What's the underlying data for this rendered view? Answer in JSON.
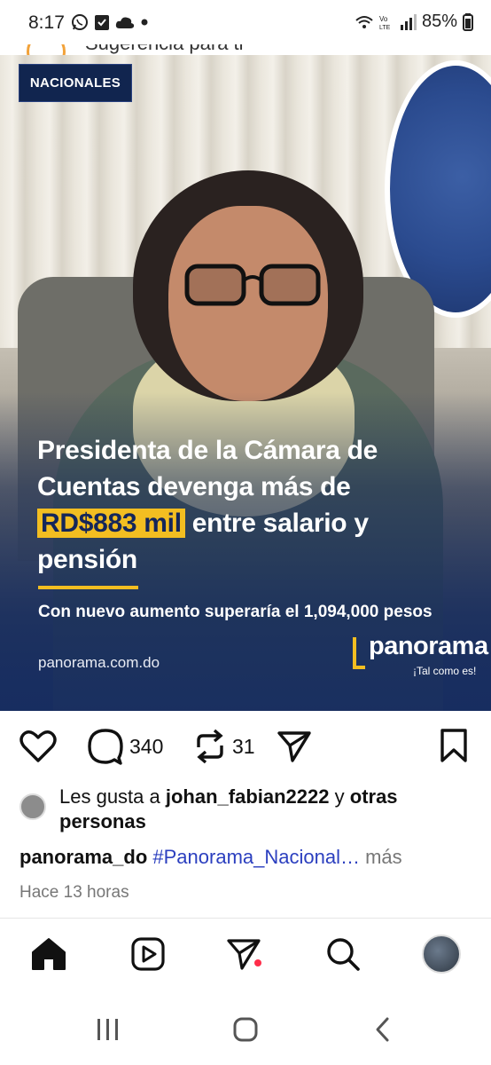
{
  "status_bar": {
    "time": "8:17",
    "battery": "85%",
    "left_icons": [
      "whatsapp-icon",
      "checkbox-icon",
      "cloud-icon",
      "dot-icon"
    ],
    "right_icons": [
      "wifi-icon",
      "volte-icon",
      "signal-icon",
      "battery-icon"
    ]
  },
  "suggestion_row": {
    "text": "Sugerencia para ti"
  },
  "post_image": {
    "badge": "NACIONALES",
    "headline_line1": "Presidenta de la Cámara de",
    "headline_line2": "Cuentas devenga más de",
    "headline_highlight": "RD$883 mil",
    "headline_line3_rest": " entre salario y",
    "headline_line4": "pensión",
    "subhead": "Con nuevo aumento superaría el 1,094,000 pesos",
    "site": "panorama.com.do",
    "logo_word": "panorama",
    "logo_tagline": "¡Tal como es!",
    "colors": {
      "navy": "#11254f",
      "accent": "#f3be21"
    }
  },
  "actions": {
    "comments_count": "340",
    "reposts_count": "31"
  },
  "likes": {
    "prefix": "Les gusta a ",
    "user": "johan_fabian2222",
    "middle": " y ",
    "others": "otras",
    "suffix": " personas"
  },
  "caption": {
    "username": "panorama_do",
    "hashtag": "#Panorama_Nacional…",
    "more": "más"
  },
  "timestamp": "Hace 13 horas",
  "bottom_nav": [
    "home-icon",
    "reels-icon",
    "messages-icon",
    "search-icon",
    "profile-avatar"
  ]
}
